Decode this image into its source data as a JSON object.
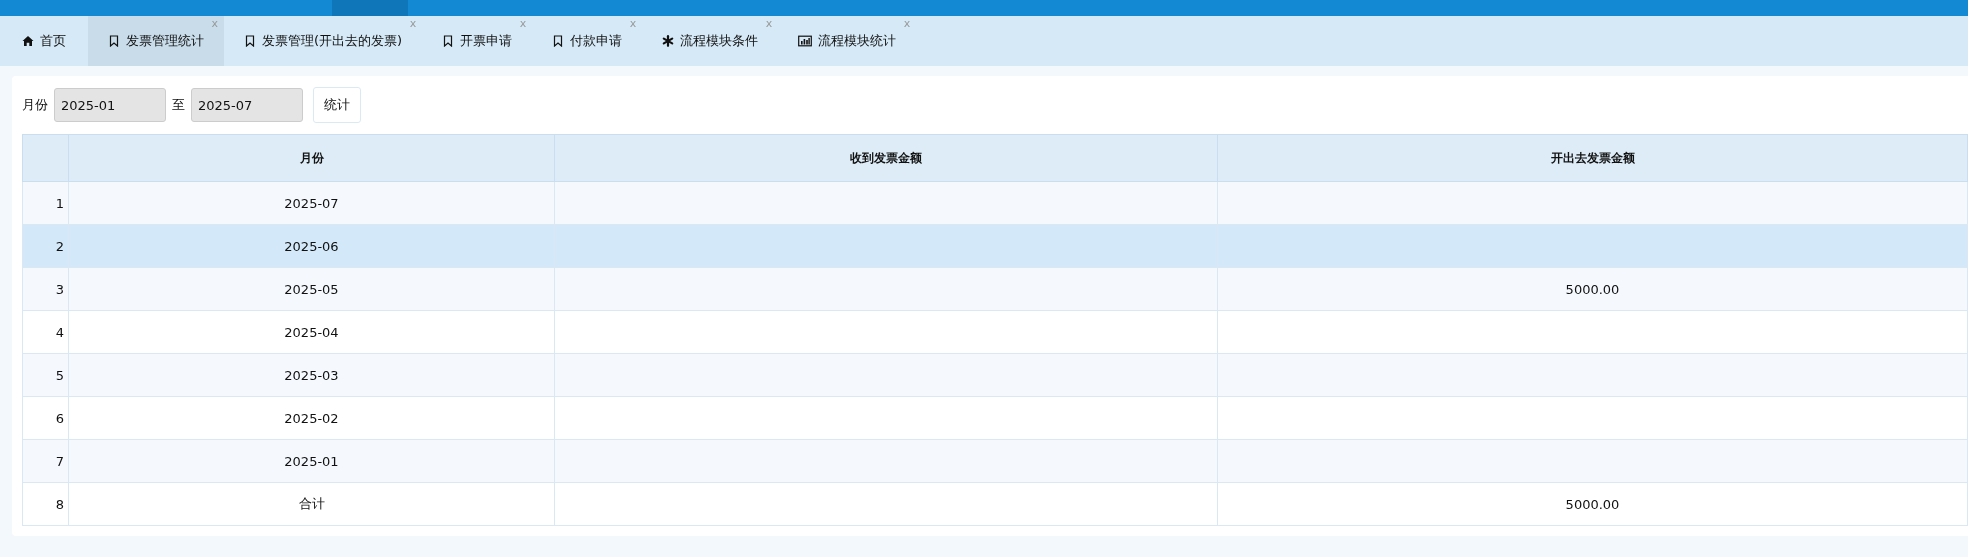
{
  "tabs": [
    {
      "label": "首页",
      "kind": "home",
      "selected": false
    },
    {
      "label": "发票管理统计",
      "kind": "bookmark",
      "close": "x",
      "selected": true
    },
    {
      "label": "发票管理(开出去的发票)",
      "kind": "bookmark",
      "close": "x",
      "selected": false
    },
    {
      "label": "开票申请",
      "kind": "bookmark",
      "close": "x",
      "selected": false
    },
    {
      "label": "付款申请",
      "kind": "bookmark",
      "close": "x",
      "selected": false
    },
    {
      "label": "流程模块条件",
      "kind": "asterisk",
      "close": "x",
      "selected": false
    },
    {
      "label": "流程模块统计",
      "kind": "chart",
      "close": "x",
      "selected": false
    }
  ],
  "filter": {
    "label": "月份",
    "from": "2025-01",
    "separator": "至",
    "to": "2025-07",
    "button": "统计"
  },
  "table": {
    "columns": [
      "月份",
      "收到发票金额",
      "开出去发票金额"
    ],
    "rows": [
      {
        "index": "1",
        "month": "2025-07",
        "received": "",
        "issued": "",
        "selected": false
      },
      {
        "index": "2",
        "month": "2025-06",
        "received": "",
        "issued": "",
        "selected": true
      },
      {
        "index": "3",
        "month": "2025-05",
        "received": "",
        "issued": "5000.00",
        "selected": false
      },
      {
        "index": "4",
        "month": "2025-04",
        "received": "",
        "issued": "",
        "selected": false
      },
      {
        "index": "5",
        "month": "2025-03",
        "received": "",
        "issued": "",
        "selected": false
      },
      {
        "index": "6",
        "month": "2025-02",
        "received": "",
        "issued": "",
        "selected": false
      },
      {
        "index": "7",
        "month": "2025-01",
        "received": "",
        "issued": "",
        "selected": false
      },
      {
        "index": "8",
        "month": "合计",
        "received": "",
        "issued": "5000.00",
        "selected": false
      }
    ]
  }
}
